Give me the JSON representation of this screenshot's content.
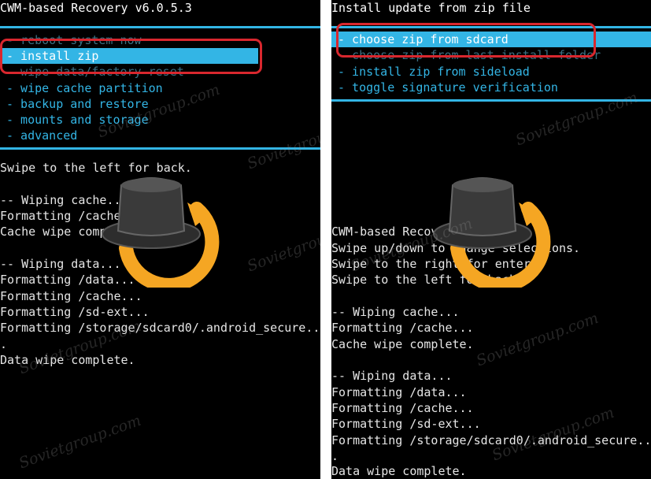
{
  "left": {
    "title": "CWM-based Recovery v6.0.5.3",
    "menu": [
      "- reboot system now",
      "- install zip",
      "- wipe data/factory reset",
      "- wipe cache partition",
      "- backup and restore",
      "- mounts and storage",
      "- advanced"
    ],
    "selected_index": 1,
    "log": [
      "Swipe to the left for back.",
      "",
      "-- Wiping cache...",
      "Formatting /cache...",
      "Cache wipe complete.",
      "",
      "-- Wiping data...",
      "Formatting /data...",
      "Formatting /cache...",
      "Formatting /sd-ext...",
      "Formatting /storage/sdcard0/.android_secure...",
      ".",
      "Data wipe complete."
    ]
  },
  "right": {
    "title": "Install update from zip file",
    "menu": [
      "- choose zip from sdcard",
      "- choose zip from last install folder",
      "- install zip from sideload",
      "- toggle signature verification"
    ],
    "selected_index": 0,
    "log": [
      "CWM-based Recovery v6.0.5.3",
      "Swipe up/down to change selections.",
      "Swipe to the right for enter.",
      "Swipe to the left for back.",
      "",
      "-- Wiping cache...",
      "Formatting /cache...",
      "Cache wipe complete.",
      "",
      "-- Wiping data...",
      "Formatting /data...",
      "Formatting /cache...",
      "Formatting /sd-ext...",
      "Formatting /storage/sdcard0/.android_secure...",
      ".",
      "Data wipe complete."
    ]
  },
  "watermark": "Sovietgroup.com",
  "colors": {
    "accent": "#33b5e5",
    "highlight": "#d9272e",
    "background": "#000000"
  }
}
